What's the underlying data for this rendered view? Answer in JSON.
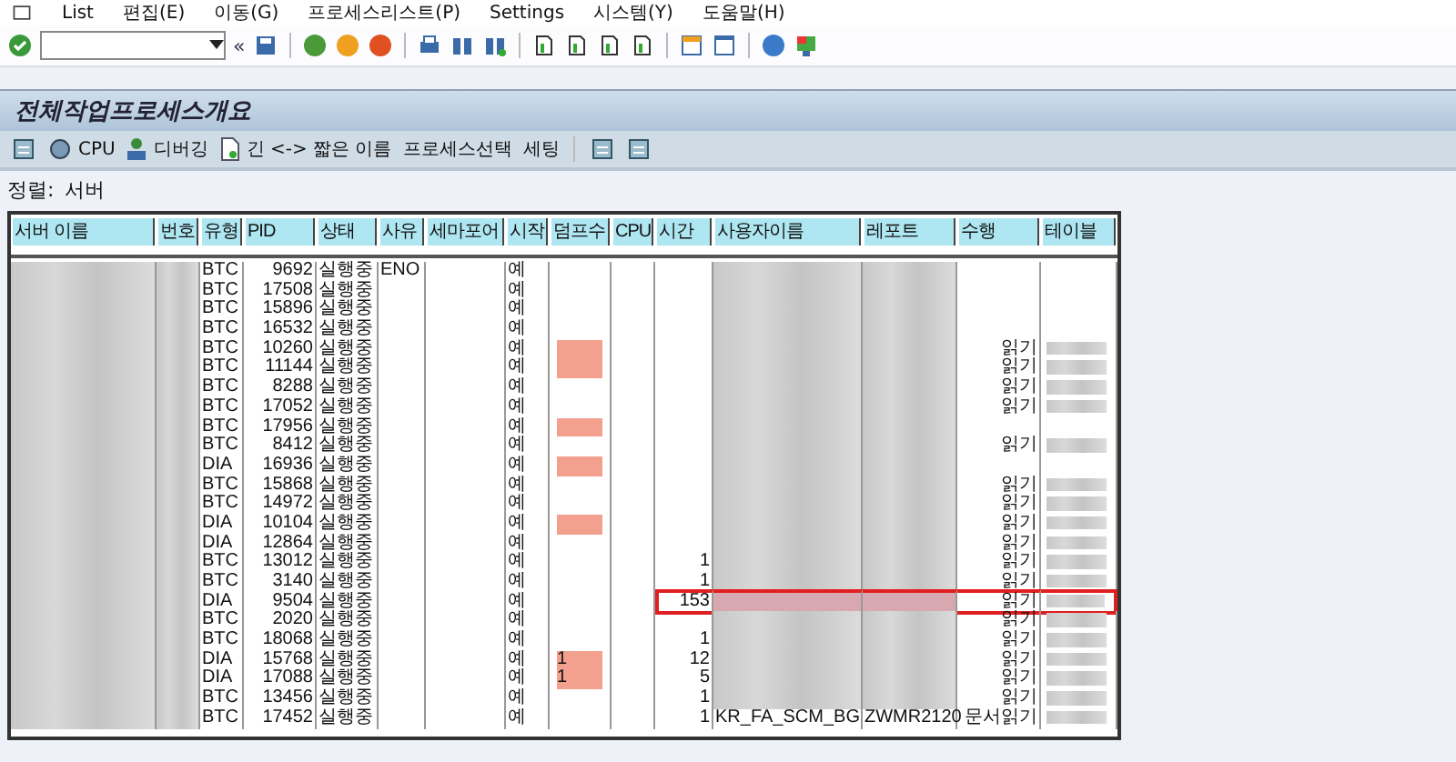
{
  "menu": [
    "List",
    "편집(E)",
    "이동(G)",
    "프로세스리스트(P)",
    "Settings",
    "시스템(Y)",
    "도움말(H)"
  ],
  "toolbar": {
    "nav_glyph": "«"
  },
  "title": "전체작업프로세스개요",
  "app_toolbar": [
    {
      "kind": "icon"
    },
    {
      "kind": "icon_text",
      "label": "CPU"
    },
    {
      "kind": "user",
      "label": "디버깅"
    },
    {
      "kind": "doc",
      "label": "긴 <-> 짧은 이름"
    },
    {
      "kind": "text",
      "label": "프로세스선택"
    },
    {
      "kind": "text",
      "label": "세팅"
    },
    {
      "kind": "sep"
    },
    {
      "kind": "icon"
    },
    {
      "kind": "icon"
    }
  ],
  "sort": {
    "label": "정렬:",
    "value": "서버"
  },
  "table": {
    "columns": [
      "서버 이름",
      "번호",
      "유형",
      "PID",
      "상태",
      "사유",
      "세마포어",
      "시작",
      "덤프수",
      "CPU",
      "시간",
      "사용자이름",
      "레포트",
      "수행",
      "테이블"
    ],
    "rows": [
      {
        "type": "BTC",
        "pid": "9692",
        "status": "실행중",
        "reason": "ENO",
        "start": "예",
        "dump_flag": false,
        "highlighted": false
      },
      {
        "type": "BTC",
        "pid": "17508",
        "status": "실행중",
        "start": "예",
        "dump_flag": false,
        "highlighted": false
      },
      {
        "type": "BTC",
        "pid": "15896",
        "status": "실행중",
        "start": "예",
        "dump_flag": false,
        "highlighted": false
      },
      {
        "type": "BTC",
        "pid": "16532",
        "status": "실행중",
        "start": "예",
        "dump_flag": false,
        "highlighted": false
      },
      {
        "type": "BTC",
        "pid": "10260",
        "status": "실행중",
        "start": "예",
        "dump_flag": true,
        "action": "읽기",
        "highlighted": false
      },
      {
        "type": "BTC",
        "pid": "11144",
        "status": "실행중",
        "start": "예",
        "dump_flag": true,
        "action": "읽기",
        "highlighted": false
      },
      {
        "type": "BTC",
        "pid": "8288",
        "status": "실행중",
        "start": "예",
        "dump_flag": false,
        "action": "읽기",
        "highlighted": false
      },
      {
        "type": "BTC",
        "pid": "17052",
        "status": "실행중",
        "start": "예",
        "dump_flag": false,
        "action": "읽기",
        "highlighted": false
      },
      {
        "type": "BTC",
        "pid": "17956",
        "status": "실행중",
        "start": "예",
        "dump_flag": true,
        "highlighted": false
      },
      {
        "type": "BTC",
        "pid": "8412",
        "status": "실행중",
        "start": "예",
        "dump_flag": false,
        "action": "읽기",
        "highlighted": false
      },
      {
        "type": "DIA",
        "pid": "16936",
        "status": "실행중",
        "start": "예",
        "dump_flag": true,
        "highlighted": false
      },
      {
        "type": "BTC",
        "pid": "15868",
        "status": "실행중",
        "start": "예",
        "dump_flag": false,
        "action": "읽기",
        "highlighted": false
      },
      {
        "type": "BTC",
        "pid": "14972",
        "status": "실행중",
        "start": "예",
        "dump_flag": false,
        "action": "읽기",
        "highlighted": false
      },
      {
        "type": "DIA",
        "pid": "10104",
        "status": "실행중",
        "start": "예",
        "dump_flag": true,
        "action": "읽기",
        "highlighted": false
      },
      {
        "type": "DIA",
        "pid": "12864",
        "status": "실행중",
        "start": "예",
        "dump_flag": false,
        "action": "읽기",
        "highlighted": false
      },
      {
        "type": "BTC",
        "pid": "13012",
        "status": "실행중",
        "start": "예",
        "dump_flag": false,
        "time": "1",
        "action": "읽기",
        "highlighted": false
      },
      {
        "type": "BTC",
        "pid": "3140",
        "status": "실행중",
        "start": "예",
        "dump_flag": false,
        "time": "1",
        "action": "읽기",
        "highlighted": false
      },
      {
        "type": "DIA",
        "pid": "9504",
        "status": "실행중",
        "start": "예",
        "dump_flag": false,
        "time": "153",
        "action": "읽기",
        "highlighted": true
      },
      {
        "type": "BTC",
        "pid": "2020",
        "status": "실행중",
        "start": "예",
        "dump_flag": false,
        "action": "읽기",
        "highlighted": false
      },
      {
        "type": "BTC",
        "pid": "18068",
        "status": "실행중",
        "start": "예",
        "dump_flag": false,
        "time": "1",
        "action": "읽기",
        "highlighted": false
      },
      {
        "type": "DIA",
        "pid": "15768",
        "status": "실행중",
        "start": "예",
        "dump": "1",
        "dump_flag": true,
        "time": "12",
        "action": "읽기",
        "highlighted": false
      },
      {
        "type": "DIA",
        "pid": "17088",
        "status": "실행중",
        "start": "예",
        "dump": "1",
        "dump_flag": true,
        "time": "5",
        "action": "읽기",
        "highlighted": false
      },
      {
        "type": "BTC",
        "pid": "13456",
        "status": "실행중",
        "start": "예",
        "dump_flag": false,
        "time": "1",
        "action": "읽기",
        "highlighted": false
      },
      {
        "type": "BTC",
        "pid": "17452",
        "status": "실행중",
        "start": "예",
        "dump_flag": false,
        "time": "1",
        "user": "KR_FA_SCM_BG",
        "report": "ZWMR2120",
        "action": "문서읽기",
        "highlighted": false
      }
    ]
  }
}
